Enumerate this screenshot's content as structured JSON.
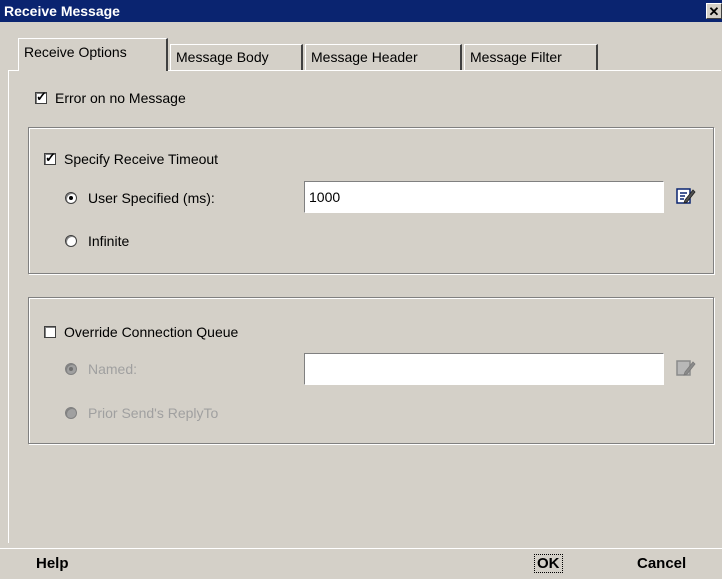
{
  "window": {
    "title": "Receive Message",
    "close_glyph": "✕"
  },
  "tabs": [
    {
      "label": "Receive Options",
      "active": true
    },
    {
      "label": "Message Body",
      "active": false
    },
    {
      "label": "Message Header",
      "active": false
    },
    {
      "label": "Message Filter",
      "active": false
    }
  ],
  "options": {
    "error_on_no_message": {
      "label": "Error on no Message",
      "checked": true
    },
    "timeout": {
      "label": "Specify Receive Timeout",
      "checked": true,
      "user_specified": {
        "label": "User Specified (ms):",
        "selected": true,
        "value": "1000"
      },
      "infinite": {
        "label": "Infinite",
        "selected": false
      }
    },
    "override_queue": {
      "label": "Override Connection Queue",
      "checked": false,
      "named": {
        "label": "Named:",
        "selected": true,
        "value": ""
      },
      "prior_send": {
        "label": "Prior Send's ReplyTo",
        "selected": false
      }
    }
  },
  "footer": {
    "help": "Help",
    "ok": "OK",
    "cancel": "Cancel"
  },
  "colors": {
    "title_bar": "#0a2470",
    "dialog_bg": "#d4d0c8",
    "disabled_text": "#a0a0a0"
  }
}
